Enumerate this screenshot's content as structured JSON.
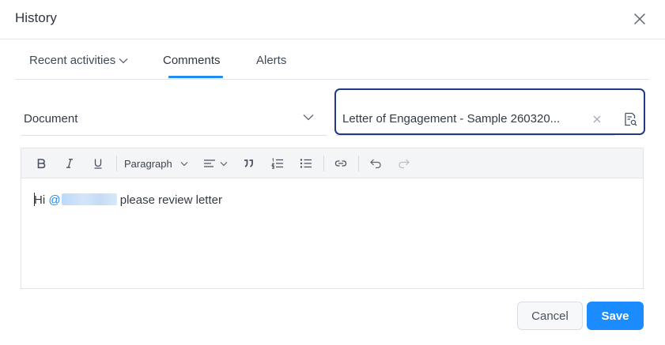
{
  "dialog": {
    "title": "History"
  },
  "tabs": [
    {
      "label": "Recent activities",
      "has_dropdown": true
    },
    {
      "label": "Comments",
      "active": true
    },
    {
      "label": "Alerts"
    }
  ],
  "form": {
    "document_select_value": "Document",
    "letter_value": "Letter of Engagement - Sample 260320..."
  },
  "toolbar": {
    "paragraph_label": "Paragraph"
  },
  "editor": {
    "text_before": "Hi",
    "mention_at": "@",
    "text_after": " please review letter"
  },
  "buttons": {
    "cancel": "Cancel",
    "save": "Save"
  },
  "colors": {
    "accent": "#1e8cf0",
    "focus_border": "#1f3a8a",
    "save_bg": "#1a8cff"
  }
}
